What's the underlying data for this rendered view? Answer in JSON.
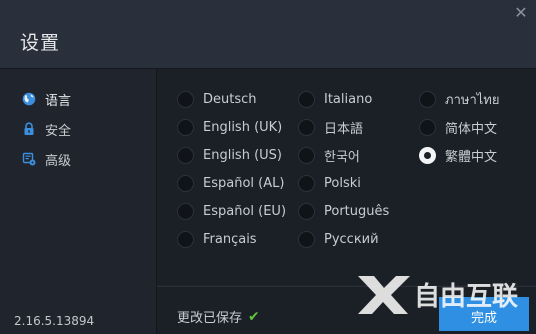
{
  "window": {
    "title": "设置",
    "close_glyph": "✕"
  },
  "sidebar": {
    "items": [
      {
        "label": "语言",
        "icon": "globe-icon",
        "active": true
      },
      {
        "label": "安全",
        "icon": "lock-icon",
        "active": false
      },
      {
        "label": "高级",
        "icon": "advanced-settings-icon",
        "active": false
      }
    ],
    "version": "2.16.5.13894"
  },
  "languages": [
    {
      "label": "Deutsch",
      "selected": false
    },
    {
      "label": "English (UK)",
      "selected": false
    },
    {
      "label": "English (US)",
      "selected": false
    },
    {
      "label": "Español (AL)",
      "selected": false
    },
    {
      "label": "Español (EU)",
      "selected": false
    },
    {
      "label": "Français",
      "selected": false
    },
    {
      "label": "Italiano",
      "selected": false
    },
    {
      "label": "日本語",
      "selected": false
    },
    {
      "label": "한국어",
      "selected": false
    },
    {
      "label": "Polski",
      "selected": false
    },
    {
      "label": "Português",
      "selected": false
    },
    {
      "label": "Русский",
      "selected": false
    },
    {
      "label": "ภาษาไทย",
      "selected": false
    },
    {
      "label": "简体中文",
      "selected": false
    },
    {
      "label": "繁體中文",
      "selected": true
    }
  ],
  "footer": {
    "saved_text": "更改已保存",
    "saved_icon": "checkmark-icon",
    "done_label": "完成"
  },
  "watermark": {
    "text": "自由互联"
  },
  "colors": {
    "accent": "#2f8fe2",
    "success": "#5dc43a",
    "header_bg": "#2a303b",
    "panel_bg": "#1b1f26"
  }
}
